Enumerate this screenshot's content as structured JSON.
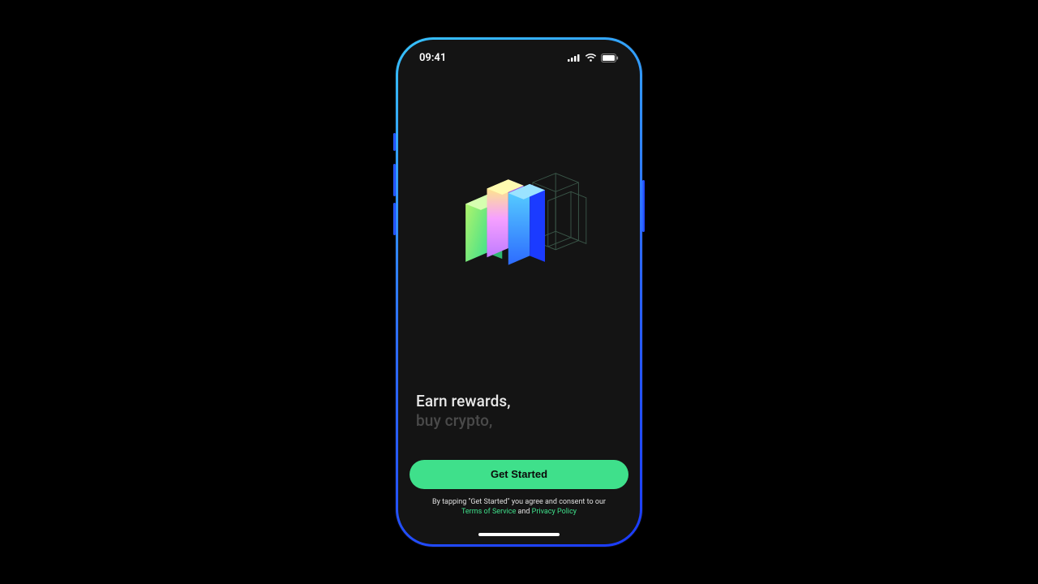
{
  "status": {
    "time": "09:41"
  },
  "hero": {
    "tagline_line1": "Earn rewards,",
    "tagline_line2": "buy crypto,"
  },
  "cta": {
    "primary_label": "Get Started"
  },
  "legal": {
    "prefix": "By tapping \"Get Started\" you agree and consent to our",
    "terms_label": "Terms of Service",
    "joiner": " and ",
    "privacy_label": "Privacy Policy"
  }
}
